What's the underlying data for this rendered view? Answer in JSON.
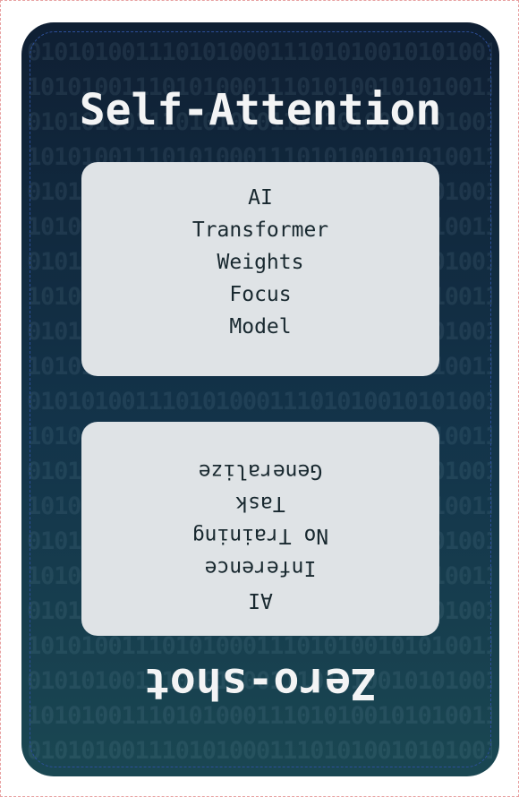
{
  "card": {
    "top_title": "Self-Attention",
    "bottom_title": "Zero-shot",
    "top_words": [
      "AI",
      "Transformer",
      "Weights",
      "Focus",
      "Model"
    ],
    "bottom_words": [
      "AI",
      "Inference",
      "No Training",
      "Task",
      "Generalize"
    ],
    "binary_rows": [
      "01010100111010100011101010010101001",
      "10101001110101000111010100101010011",
      "01010100111010100011101010010101001",
      "10101001110101000111010100101010011",
      "01010100111010100011101010010101001",
      "10101001110101000111010100101010011",
      "01010100111010100011101010010101001",
      "10101001110101000111010100101010011",
      "01010100111010100011101010010101001",
      "10101001110101000111010100101010011",
      "01010100111010100011101010010101001",
      "10101001110101000111010100101010011",
      "01010100111010100011101010010101001",
      "10101001110101000111010100101010011",
      "01010100111010100011101010010101001",
      "10101001110101000111010100101010011",
      "01010100111010100011101010010101001",
      "10101001110101000111010100101010011",
      "01010100111010100011101010010101001",
      "10101001110101000111010100101010011",
      "01010100111010100011101010010101001"
    ],
    "colors": {
      "background_top": "#0f1f33",
      "background_bottom": "#1a4752",
      "panel": "#dfe3e6",
      "title_text": "#f3f4f5",
      "word_text": "#18282f",
      "border": "#2d4f9a"
    }
  }
}
